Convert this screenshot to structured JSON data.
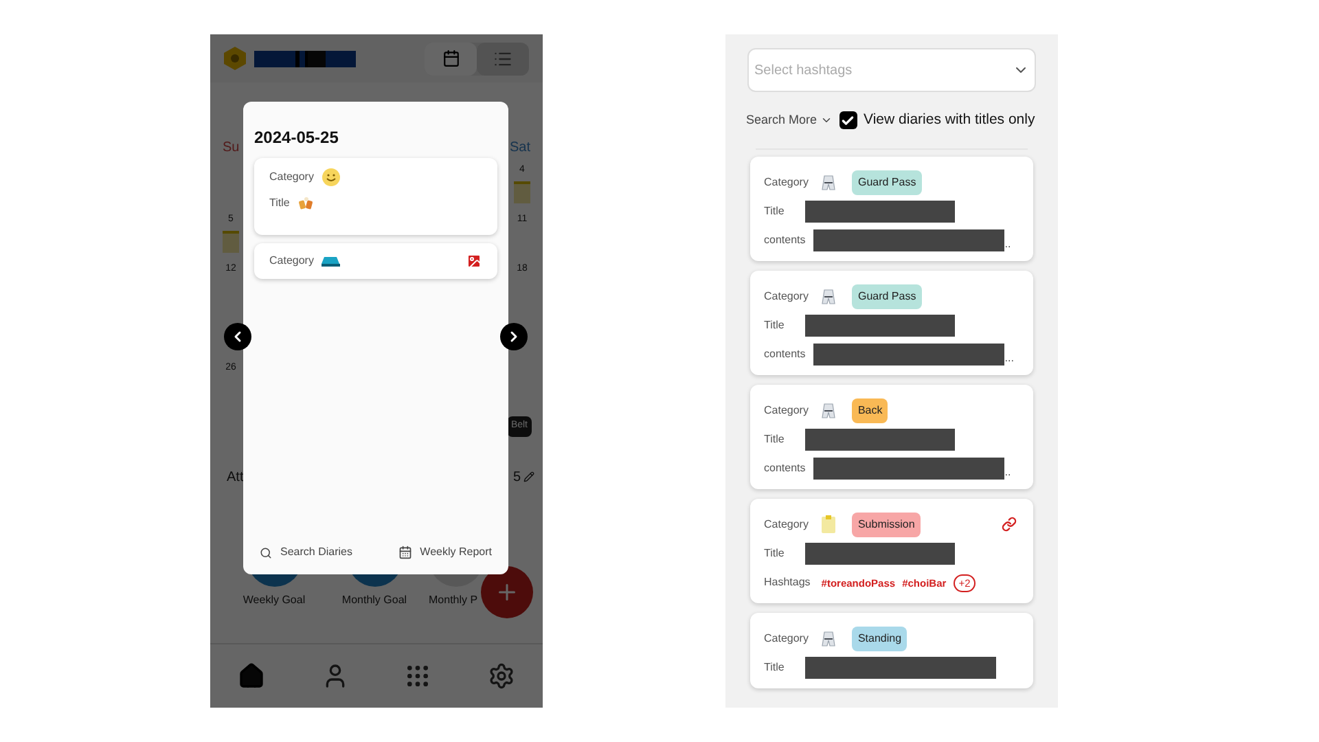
{
  "left_screen": {
    "header": {
      "view_toggle": [
        {
          "selected": true
        },
        {
          "selected": false
        }
      ]
    },
    "calendar": {
      "weekdays": [
        "Su",
        "Sat"
      ],
      "rows": [
        {
          "sunday": "",
          "saturday": "4",
          "saturday_event": true,
          "sunday_event": false
        },
        {
          "sunday": "5",
          "saturday": "11",
          "saturday_event": false,
          "sunday_event": true
        },
        {
          "sunday": "12",
          "saturday": "18",
          "saturday_event": false,
          "sunday_event": false
        },
        {
          "sunday": "",
          "saturday": "",
          "saturday_event": false,
          "sunday_event": false
        },
        {
          "sunday": "26",
          "saturday": "",
          "saturday_event": false,
          "sunday_event": false
        }
      ]
    },
    "belt_chip": "Belt",
    "attendance": {
      "label": "Att",
      "value": "5"
    },
    "goals": [
      {
        "label": "Weekly Goal"
      },
      {
        "label": "Monthly Goal"
      },
      {
        "label": "Monthly P"
      }
    ],
    "nav": [
      {
        "selected": true
      },
      {
        "selected": false
      },
      {
        "selected": false
      },
      {
        "selected": false
      }
    ],
    "modal": {
      "date": "2024-05-25",
      "entries": [
        {
          "rows": [
            {
              "label": "Category",
              "kind": "smiley"
            },
            {
              "label": "Title",
              "kind": "cheers"
            }
          ],
          "has_image": false
        },
        {
          "rows": [
            {
              "label": "Category",
              "kind": "shoe"
            }
          ],
          "has_image": true
        }
      ],
      "footer": [
        {
          "label": "Search Diaries"
        },
        {
          "label": "Weekly Report"
        }
      ]
    }
  },
  "right_screen": {
    "hashtag_select": {
      "placeholder": "Select hashtags"
    },
    "search_more": "Search More",
    "titles_only": {
      "label": "View diaries with titles only",
      "checked": true
    },
    "diaries": [
      {
        "category_label": "Category",
        "kind": "uniform",
        "tag": "Guard Pass",
        "color": "#b6e3dc",
        "linked": false,
        "rows": [
          {
            "kind": "redacted",
            "label": "Title"
          },
          {
            "kind": "redacted",
            "label": "contents",
            "suffix": ".."
          }
        ]
      },
      {
        "category_label": "Category",
        "kind": "uniform",
        "tag": "Guard Pass",
        "color": "#b6e3dc",
        "linked": false,
        "rows": [
          {
            "kind": "redacted",
            "label": "Title"
          },
          {
            "kind": "redacted",
            "label": "contents",
            "suffix": "..."
          }
        ]
      },
      {
        "category_label": "Category",
        "kind": "uniform",
        "tag": "Back",
        "color": "#f9b955",
        "linked": false,
        "rows": [
          {
            "kind": "redacted",
            "label": "Title"
          },
          {
            "kind": "redacted",
            "label": "contents",
            "suffix": ".."
          }
        ]
      },
      {
        "category_label": "Category",
        "kind": "note",
        "tag": "Submission",
        "color": "#f7a6a6",
        "linked": true,
        "rows": [
          {
            "kind": "redacted",
            "label": "Title"
          },
          {
            "kind": "hashtags",
            "label": "Hashtags",
            "tags": [
              "#toreandoPass",
              "#choiBar"
            ],
            "more": "+2"
          }
        ]
      },
      {
        "category_label": "Category",
        "kind": "uniform",
        "tag": "Standing",
        "color": "#a9d9ea",
        "linked": false,
        "rows": [
          {
            "kind": "redacted",
            "label": "Title"
          }
        ]
      }
    ]
  }
}
